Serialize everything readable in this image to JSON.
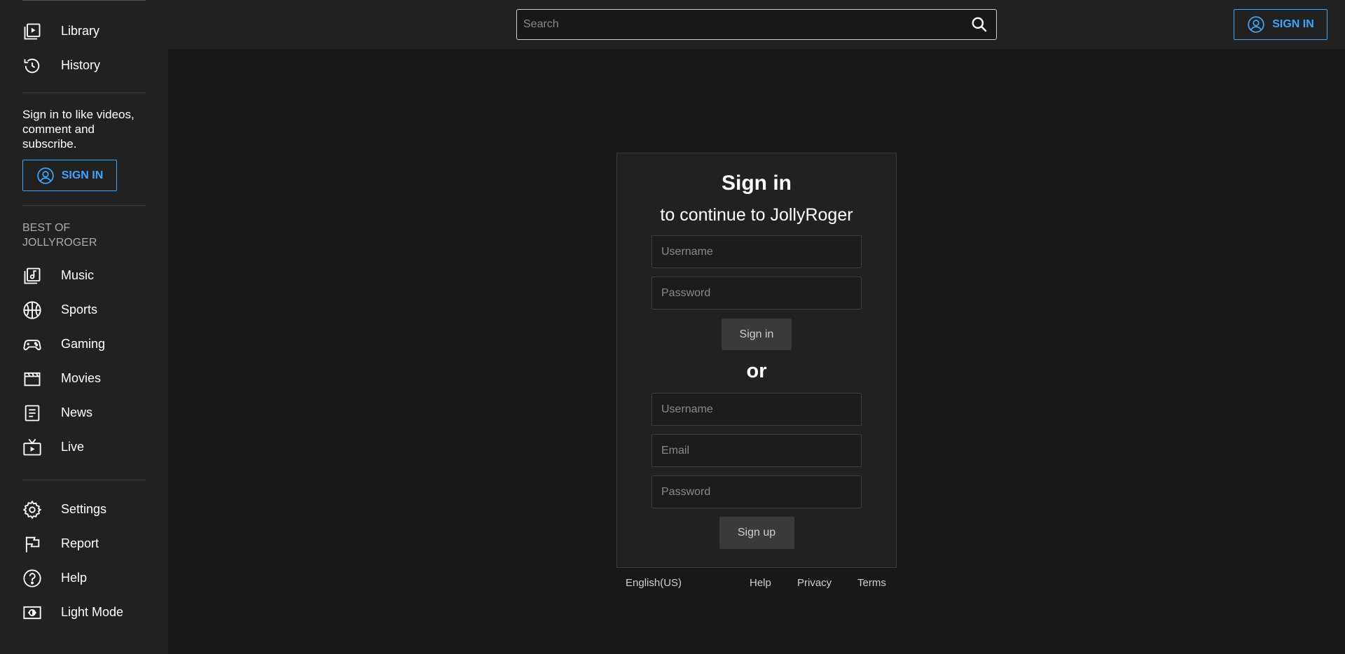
{
  "sidebar": {
    "nav_top": [
      {
        "label": "Library",
        "icon": "library-icon"
      },
      {
        "label": "History",
        "icon": "history-icon"
      }
    ],
    "signin_promo": "Sign in to like videos, comment and subscribe.",
    "signin_label": "SIGN IN",
    "section_title": "BEST OF JOLLYROGER",
    "best_of": [
      {
        "label": "Music",
        "icon": "music-icon"
      },
      {
        "label": "Sports",
        "icon": "sports-icon"
      },
      {
        "label": "Gaming",
        "icon": "gaming-icon"
      },
      {
        "label": "Movies",
        "icon": "movies-icon"
      },
      {
        "label": "News",
        "icon": "news-icon"
      },
      {
        "label": "Live",
        "icon": "live-icon"
      }
    ],
    "bottom": [
      {
        "label": "Settings",
        "icon": "settings-icon"
      },
      {
        "label": "Report",
        "icon": "report-flag-icon"
      },
      {
        "label": "Help",
        "icon": "help-icon"
      },
      {
        "label": "Light Mode",
        "icon": "light-mode-icon"
      }
    ]
  },
  "header": {
    "search_placeholder": "Search",
    "signin_label": "SIGN IN"
  },
  "signin_card": {
    "title": "Sign in",
    "subtitle": "to continue to JollyRoger",
    "login": {
      "username_placeholder": "Username",
      "password_placeholder": "Password",
      "button_label": "Sign in"
    },
    "or_text": "or",
    "signup": {
      "username_placeholder": "Username",
      "email_placeholder": "Email",
      "password_placeholder": "Password",
      "button_label": "Sign up"
    }
  },
  "footer": {
    "language": "English(US)",
    "help": "Help",
    "privacy": "Privacy",
    "terms": "Terms"
  },
  "colors": {
    "background": "#181818",
    "surface": "#212121",
    "accent": "#3ea6ff",
    "button": "#3a3a3a"
  }
}
